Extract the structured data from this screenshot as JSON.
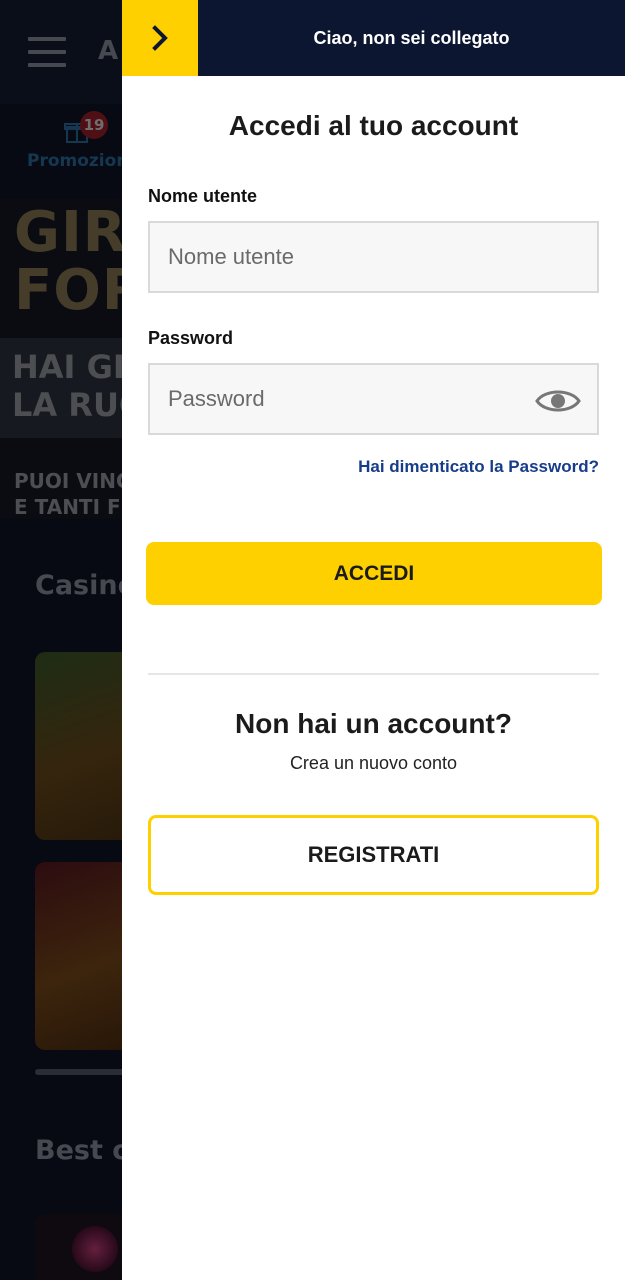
{
  "background": {
    "logo_text": "A",
    "promo_badge": "19",
    "promo_label": "Promozion",
    "banner_big": "GIR\nFOR",
    "banner_mid": "HAI GI\nLA RUC",
    "banner_small": "PUOI VINC\nE TANTI FI",
    "section_casino": "Casino",
    "section_best": "Best o"
  },
  "drawer": {
    "greeting": "Ciao, non sei collegato",
    "title": "Accedi al tuo account",
    "username": {
      "label": "Nome utente",
      "placeholder": "Nome utente",
      "value": ""
    },
    "password": {
      "label": "Password",
      "placeholder": "Password",
      "value": ""
    },
    "forgot_link": "Hai dimenticato la Password?",
    "login_button": "ACCEDI",
    "no_account_title": "Non hai un account?",
    "no_account_subtitle": "Crea un nuovo conto",
    "register_button": "REGISTRATI"
  },
  "icons": {
    "close": "chevron-right-icon",
    "show_password": "eye-icon",
    "menu": "hamburger-icon",
    "promo": "gift-icon"
  },
  "colors": {
    "accent": "#ffd000",
    "header": "#0d1630",
    "link": "#173d8a"
  }
}
